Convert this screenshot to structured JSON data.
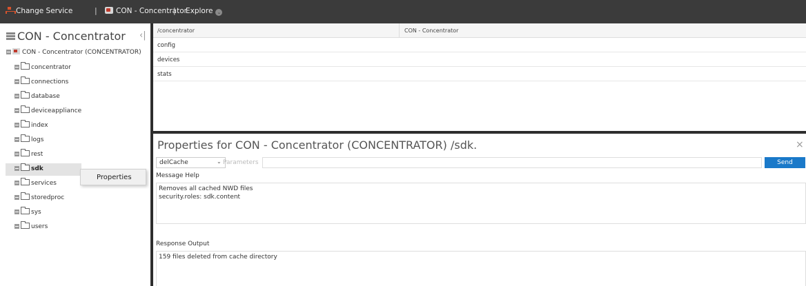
{
  "topbar": {
    "change_service": "Change Service",
    "service_name": "CON - Concentrator",
    "separator": "|",
    "explore": "Explore",
    "explore_chevron": "⌄"
  },
  "tree": {
    "title": "CON - Concentrator",
    "collapse_glyph": "‹|",
    "root_label": "CON - Concentrator (CONCENTRATOR)",
    "nodes": [
      {
        "label": "concentrator"
      },
      {
        "label": "connections"
      },
      {
        "label": "database"
      },
      {
        "label": "deviceappliance"
      },
      {
        "label": "index"
      },
      {
        "label": "logs"
      },
      {
        "label": "rest"
      },
      {
        "label": "sdk"
      },
      {
        "label": "services"
      },
      {
        "label": "storedproc"
      },
      {
        "label": "sys"
      },
      {
        "label": "users"
      }
    ],
    "selected_node": "sdk",
    "context_menu": {
      "items": [
        "Properties"
      ]
    }
  },
  "table": {
    "columns": [
      "/concentrator",
      "CON - Concentrator"
    ],
    "rows": [
      "config",
      "devices",
      "stats"
    ]
  },
  "properties": {
    "title": "Properties for CON - Concentrator (CONCENTRATOR) /sdk.",
    "close_glyph": "×",
    "command": "delCache",
    "params_placeholder": "Parameters",
    "params_value": "",
    "send_label": "Send",
    "message_help_label": "Message Help",
    "message_help_lines": [
      "Removes all cached NWD files",
      "security.roles: sdk.content"
    ],
    "response_output_label": "Response Output",
    "response_output_lines": [
      "159 files deleted from cache directory"
    ]
  },
  "colors": {
    "topbar_bg": "#3b3b3b",
    "send_button": "#1a79c9",
    "splitter": "#2e2e2e"
  },
  "icons": [
    "tree-icon",
    "concentrator-icon",
    "chevron-down-icon",
    "server-icon",
    "collapse-icon",
    "expand-icon",
    "folder-icon",
    "close-icon"
  ]
}
